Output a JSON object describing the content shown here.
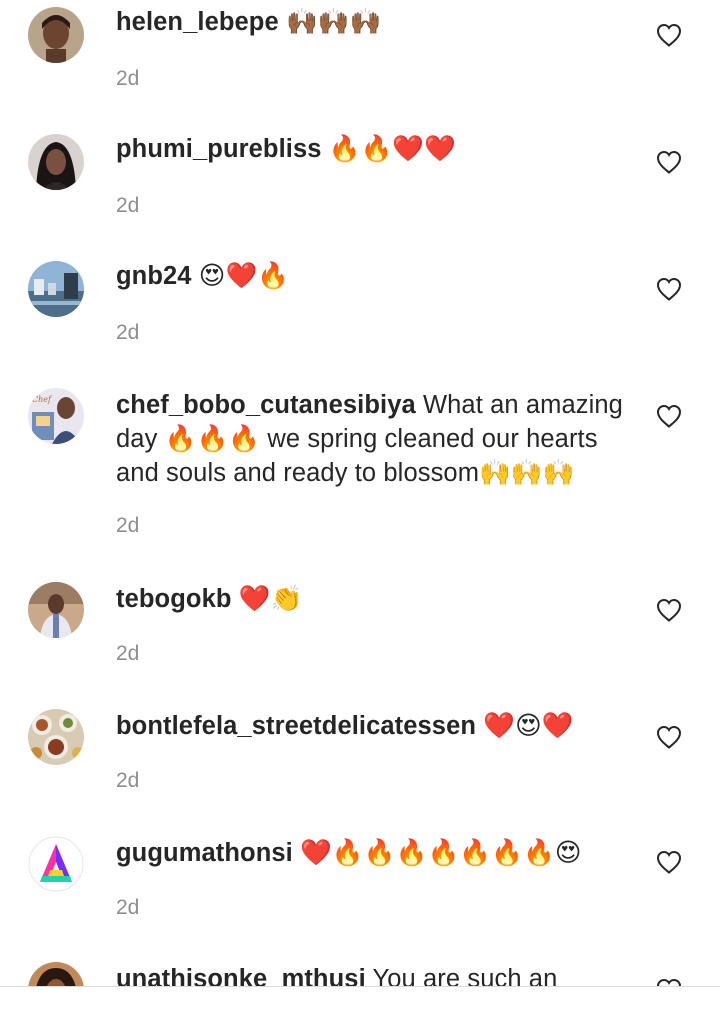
{
  "comments": [
    {
      "username": "helen_lebepe",
      "text": " 🙌🏾🙌🏾🙌🏾",
      "time": "2d"
    },
    {
      "username": "phumi_purebliss",
      "text": " 🔥🔥❤️❤️",
      "time": "2d"
    },
    {
      "username": "gnb24",
      "text": " 😍❤️🔥",
      "time": "2d"
    },
    {
      "username": "chef_bobo_cutanesibiya",
      "text": " What an amazing day 🔥🔥🔥 we spring cleaned our hearts and souls and ready to blossom🙌🙌🙌",
      "time": "2d"
    },
    {
      "username": "tebogokb",
      "text": " ❤️👏",
      "time": "2d"
    },
    {
      "username": "bontlefela_streetdelicatessen",
      "text": " ❤️😍❤️",
      "time": "2d"
    },
    {
      "username": "gugumathonsi",
      "text": " ❤️🔥🔥🔥🔥🔥🔥🔥😍",
      "time": "2d"
    },
    {
      "username": "unathisonke_mthusi",
      "text": " You are such an",
      "time": ""
    }
  ]
}
